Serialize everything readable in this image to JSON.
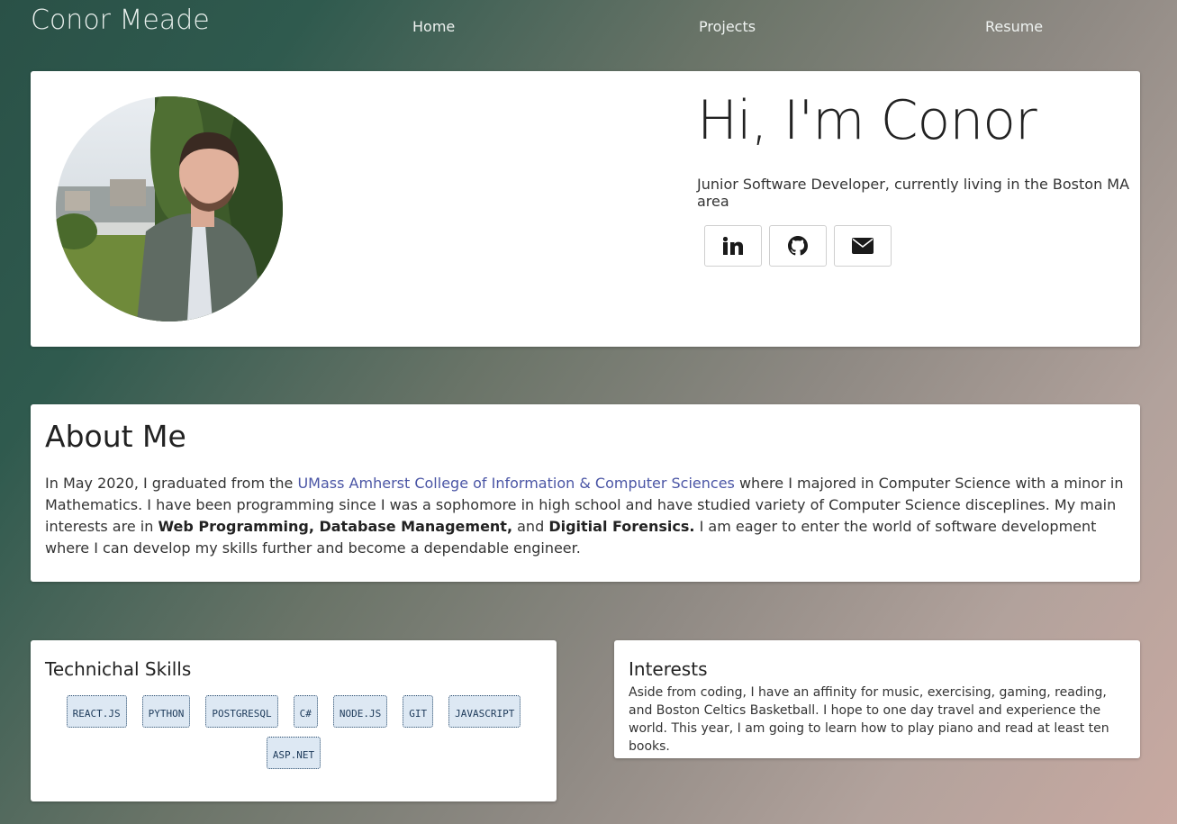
{
  "header": {
    "brand": "Conor Meade",
    "nav": [
      "Home",
      "Projects",
      "Resume"
    ]
  },
  "hero": {
    "title": "Hi, I'm Conor",
    "subtitle": "Junior Software Developer, currently living in the Boston MA area",
    "social": [
      "linkedin-icon",
      "github-icon",
      "envelope-icon"
    ]
  },
  "about": {
    "title": "About Me",
    "p1": "In May 2020, I graduated from the ",
    "link": "UMass Amherst College of Information & Computer Sciences",
    "p2": " where I majored in Computer Science with a minor in Mathematics. I have been programming since I was a sophomore in high school and have studied variety of Computer Science disceplines. My main interests are in ",
    "bold1": "Web Programming, Database Management,",
    "p3": " and ",
    "bold2": "Digitial Forensics.",
    "p4": " I am eager to enter the world of software development where I can develop my skills further and become a dependable engineer."
  },
  "skills": {
    "title": "Technichal Skills",
    "items": [
      "REACT.JS",
      "PYTHON",
      "POSTGRESQL",
      "C#",
      "NODE.JS",
      "GIT",
      "JAVASCRIPT",
      "ASP.NET"
    ]
  },
  "interests": {
    "title": "Interests",
    "text": "Aside from coding, I have an affinity for music, exercising, gaming, reading, and Boston Celtics Basketball. I hope to one day travel and experience the world. This year, I am going to learn how to play piano and read at least ten books."
  },
  "colors": {
    "link": "#4a55a5",
    "chip_bg": "#dde8f3",
    "chip_text": "#1d3a5a"
  }
}
